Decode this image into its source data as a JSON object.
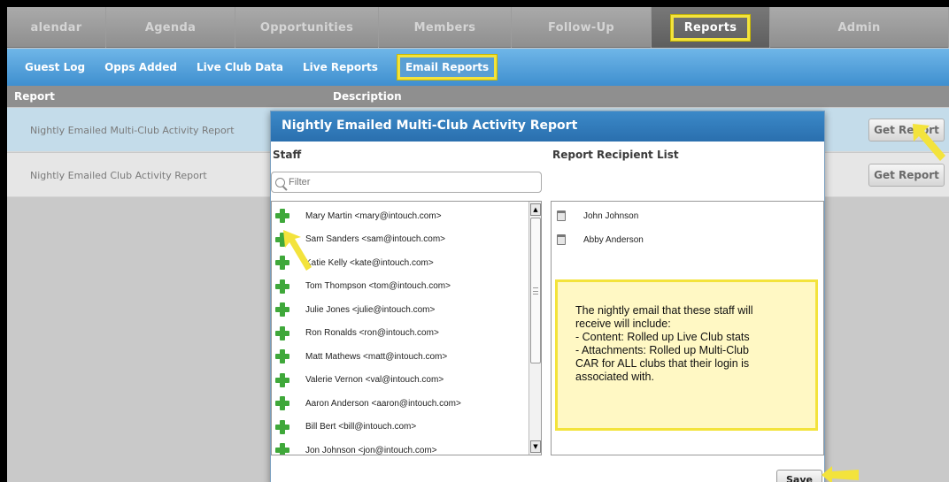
{
  "topnav": {
    "tabs": [
      {
        "label": "alendar",
        "width": 112
      },
      {
        "label": "Agenda",
        "width": 146
      },
      {
        "label": "Opportunities",
        "width": 162
      },
      {
        "label": "Members",
        "width": 150
      },
      {
        "label": "Follow-Up",
        "width": 158
      },
      {
        "label": "Reports",
        "width": 134,
        "active": true
      },
      {
        "label": "Admin",
        "width": 202
      }
    ]
  },
  "subnav": {
    "items": [
      "Guest Log",
      "Opps Added",
      "Live Club Data",
      "Live Reports",
      "Email Reports"
    ],
    "active_index": 4
  },
  "table": {
    "col_report": "Report",
    "col_description": "Description",
    "rows": [
      {
        "name": "Nightly Emailed Multi-Club Activity Report",
        "button": "Get Report"
      },
      {
        "name": "Nightly Emailed Club Activity Report",
        "button": "Get Report"
      }
    ]
  },
  "modal": {
    "title": "Nightly Emailed Multi-Club Activity Report",
    "staff_title": "Staff",
    "recipients_title": "Report Recipient List",
    "filter_placeholder": "Filter",
    "staff": [
      "Mary Martin <mary@intouch.com>",
      "Sam Sanders <sam@intouch.com>",
      "Katie Kelly <kate@intouch.com>",
      "Tom Thompson <tom@intouch.com>",
      "Julie Jones <julie@intouch.com>",
      "Ron Ronalds <ron@intouch.com>",
      "Matt Mathews <matt@intouch.com>",
      "Valerie Vernon <val@intouch.com>",
      "Aaron Anderson <aaron@intouch.com>",
      "Bill Bert <bill@intouch.com>",
      "Jon Johnson <jon@intouch.com>"
    ],
    "recipients": [
      "John Johnson",
      "Abby Anderson"
    ],
    "note": [
      "The nightly email that these staff will",
      "receive will include:",
      "- Content: Rolled up Live Club stats",
      "- Attachments: Rolled up Multi-Club",
      "CAR for ALL clubs that their login is",
      "associated with."
    ],
    "save_label": "Save"
  },
  "colors": {
    "highlight": "#f3e33c",
    "modal_header": "#2f7bbd",
    "subnav": "#4f9fd9",
    "plus": "#3fa83a"
  }
}
